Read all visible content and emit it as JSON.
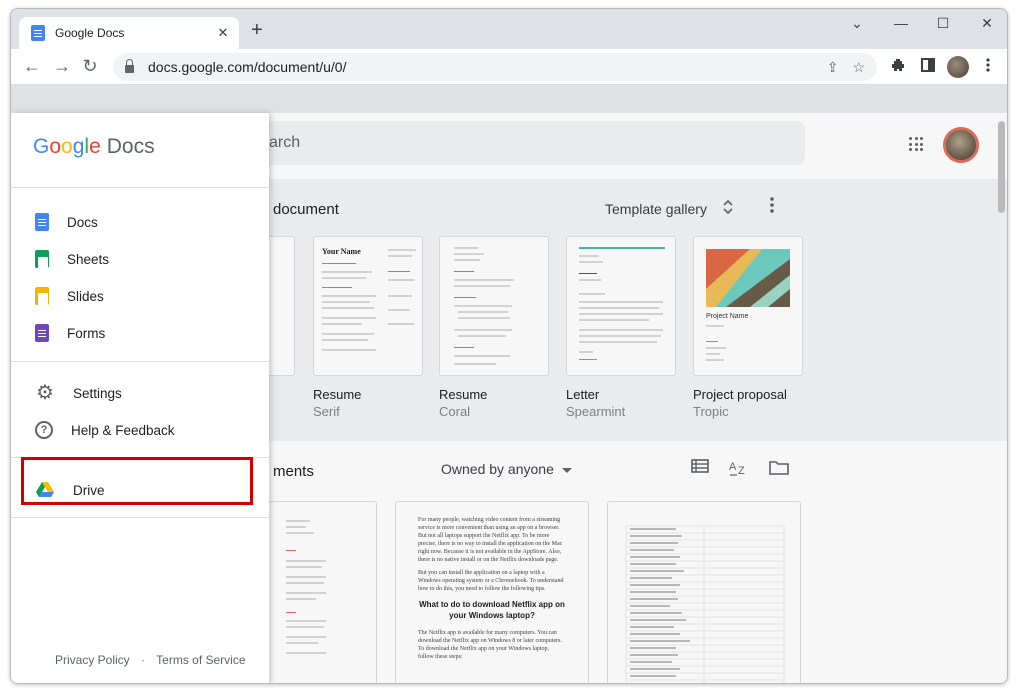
{
  "browser": {
    "tab_title": "Google Docs",
    "tab_close": "✕",
    "new_tab": "+",
    "url": "docs.google.com/document/u/0/",
    "back": "←",
    "forward": "→",
    "reload": "↻",
    "share_icon": "⇪",
    "star_icon": "☆",
    "win_minimize": "⌄",
    "win_min": "—",
    "win_max": "☐",
    "win_close": "✕"
  },
  "header": {
    "search_placeholder": "arch"
  },
  "new_doc": {
    "label": "document",
    "template_gallery": "Template gallery",
    "templates": [
      {
        "name": "",
        "sub": ""
      },
      {
        "name": "Resume",
        "sub": "Serif"
      },
      {
        "name": "Resume",
        "sub": "Coral"
      },
      {
        "name": "Letter",
        "sub": "Spearmint"
      },
      {
        "name": "Project proposal",
        "sub": "Tropic"
      }
    ]
  },
  "recent": {
    "label": "ments",
    "owned_by": "Owned by anyone",
    "doc2": {
      "p1": "For many people, watching video content from a streaming service is more convenient than using an app on a browser. But not all laptops support the Netflix app. To be more precise, there is no way to install the application on the Mac right now. Because it is not available in the AppStore. Also, there is no native install or on the Netflix downloads page.",
      "p2": "But you can install the application on a laptop with a Windows operating system or a Chromebook. To understand how to do this, you need to follow the following tips.",
      "heading": "What to do to download Netflix app on your Windows laptop?",
      "p3": "The Netflix app is available for many computers. You can download the Netflix app on Windows 8 or later computers. To download the Netflix app on your Windows laptop, follow these steps:"
    }
  },
  "drawer": {
    "logo_g1": "G",
    "logo_g2": "o",
    "logo_g3": "o",
    "logo_g4": "g",
    "logo_g5": "l",
    "logo_g6": "e",
    "logo_docs": "Docs",
    "apps": [
      "Docs",
      "Sheets",
      "Slides",
      "Forms"
    ],
    "settings": "Settings",
    "help": "Help & Feedback",
    "drive": "Drive",
    "privacy": "Privacy Policy",
    "dot": "·",
    "terms": "Terms of Service"
  },
  "colors": {
    "docs_blue": "#4285f4",
    "sheets_green": "#0f9d58",
    "slides_yellow": "#f4b400",
    "forms_purple": "#7248b9",
    "highlight_red": "#d40000"
  }
}
